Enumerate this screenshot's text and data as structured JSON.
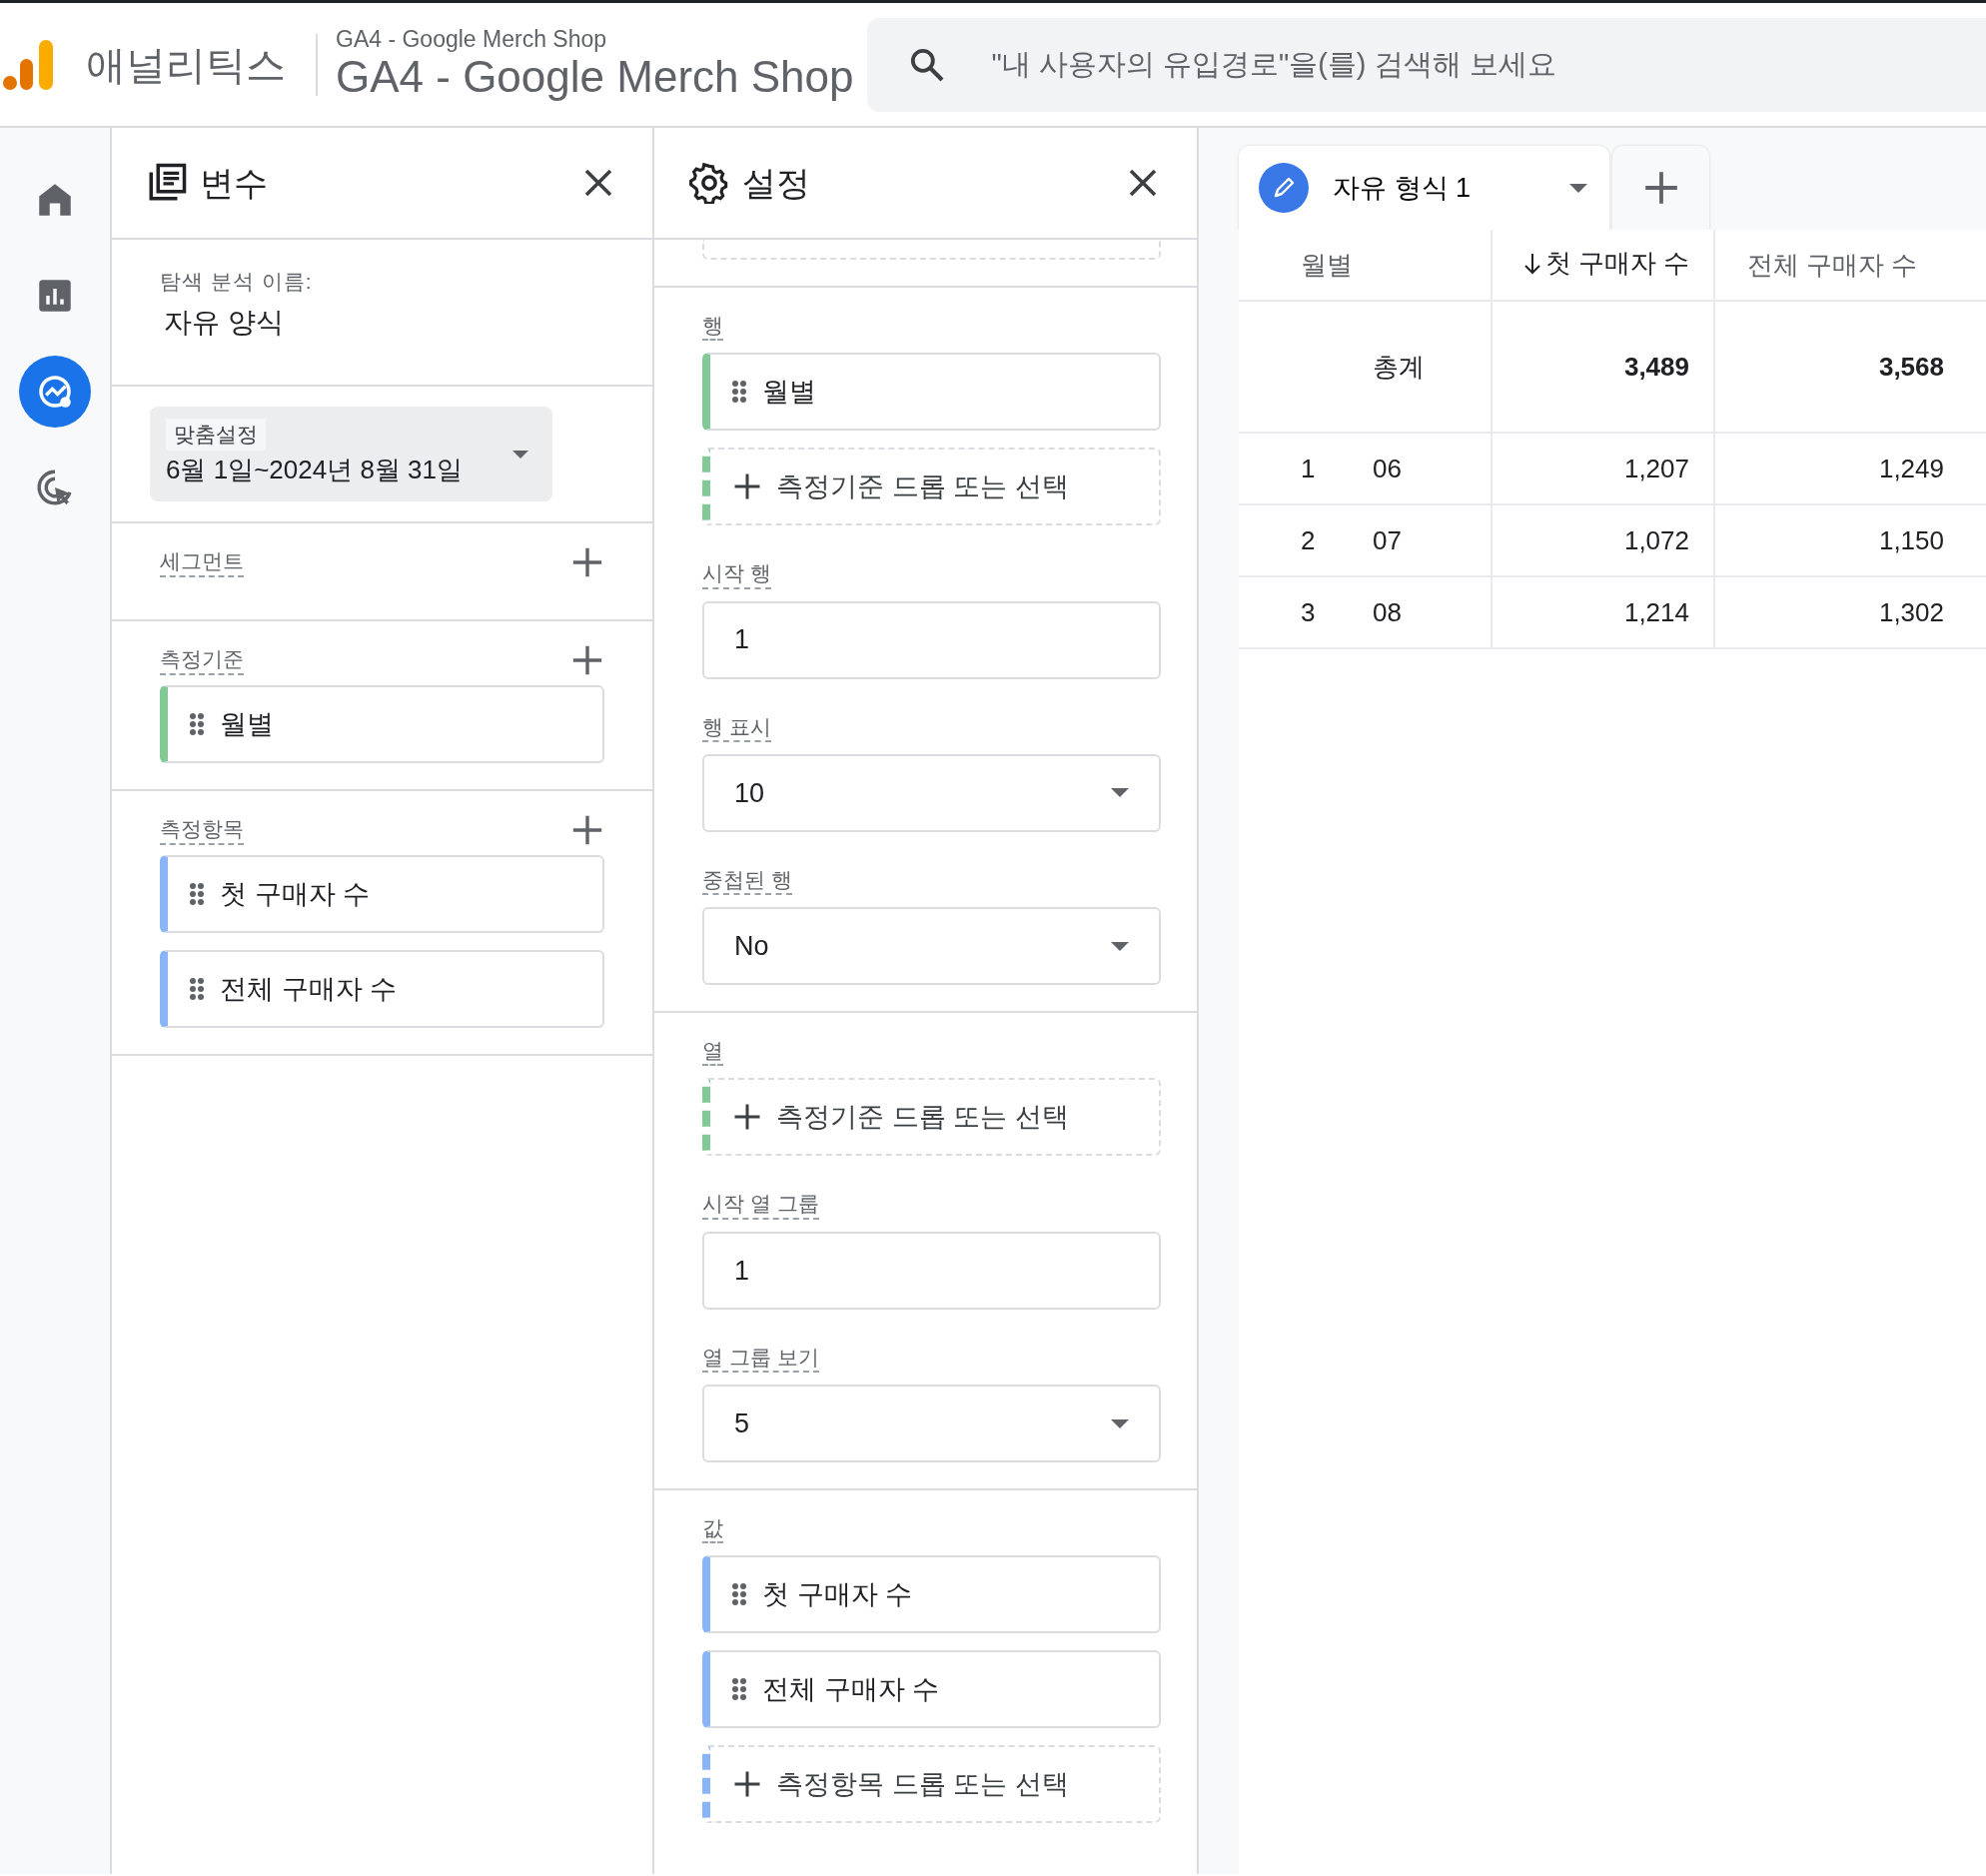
{
  "header": {
    "product": "애널리틱스",
    "account": "GA4 - Google Merch Shop",
    "property": "GA4 - Google Merch Shop",
    "search": {
      "placeholder": "\"내 사용자의 유입경로\"을(를) 검색해 보세요"
    }
  },
  "nav": [
    {
      "kind": "home",
      "selected": false
    },
    {
      "kind": "reports",
      "selected": false
    },
    {
      "kind": "explore",
      "selected": true
    },
    {
      "kind": "advertising",
      "selected": false
    }
  ],
  "variables_panel": {
    "title": "변수",
    "name_label": "탐색 분석 이름:",
    "name": "자유 양식",
    "date": {
      "label": "맞춤설정",
      "value": "6월 1일~2024년 8월 31일"
    },
    "sections": [
      {
        "label": "세그먼트"
      },
      {
        "label": "측정기준",
        "items": [
          {
            "text": "월별",
            "kind": "dimension"
          }
        ]
      },
      {
        "label": "측정항목",
        "items": [
          {
            "text": "첫 구매자 수",
            "kind": "metric"
          },
          {
            "text": "전체 구매자 수",
            "kind": "metric"
          }
        ]
      }
    ]
  },
  "settings_panel": {
    "title": "설정",
    "groups": [
      [
        {
          "label": "행",
          "kind": "chips",
          "items": [
            {
              "text": "월별",
              "kind": "dimension"
            }
          ],
          "drop": {
            "text": "측정기준 드롭 또는 선택",
            "kind": "dimension"
          }
        },
        {
          "label": "시작 행",
          "kind": "input",
          "value": "1"
        },
        {
          "label": "행 표시",
          "kind": "select",
          "value": "10"
        },
        {
          "label": "중첩된 행",
          "kind": "select",
          "value": "No"
        }
      ],
      [
        {
          "label": "열",
          "kind": "chips",
          "drop": {
            "text": "측정기준 드롭 또는 선택",
            "kind": "dimension"
          }
        },
        {
          "label": "시작 열 그룹",
          "kind": "input",
          "value": "1"
        },
        {
          "label": "열 그룹 보기",
          "kind": "select",
          "value": "5"
        }
      ],
      [
        {
          "label": "값",
          "kind": "chips",
          "items": [
            {
              "text": "첫 구매자 수",
              "kind": "metric"
            },
            {
              "text": "전체 구매자 수",
              "kind": "metric"
            }
          ],
          "drop": {
            "text": "측정항목 드롭 또는 선택",
            "kind": "metric"
          }
        }
      ]
    ]
  },
  "report": {
    "tab": {
      "title": "자유 형식 1"
    },
    "columns": [
      {
        "label": "월별",
        "sorted": false
      },
      {
        "label": "첫 구매자 수",
        "sorted": true
      },
      {
        "label": "전체 구매자 수",
        "sorted": false
      }
    ],
    "total": {
      "label": "총계",
      "values": [
        "3,489",
        "3,568"
      ]
    },
    "rows": [
      {
        "index": "1",
        "month": "06",
        "values": [
          "1,207",
          "1,249"
        ]
      },
      {
        "index": "2",
        "month": "07",
        "values": [
          "1,072",
          "1,150"
        ]
      },
      {
        "index": "3",
        "month": "08",
        "values": [
          "1,214",
          "1,302"
        ]
      }
    ]
  }
}
